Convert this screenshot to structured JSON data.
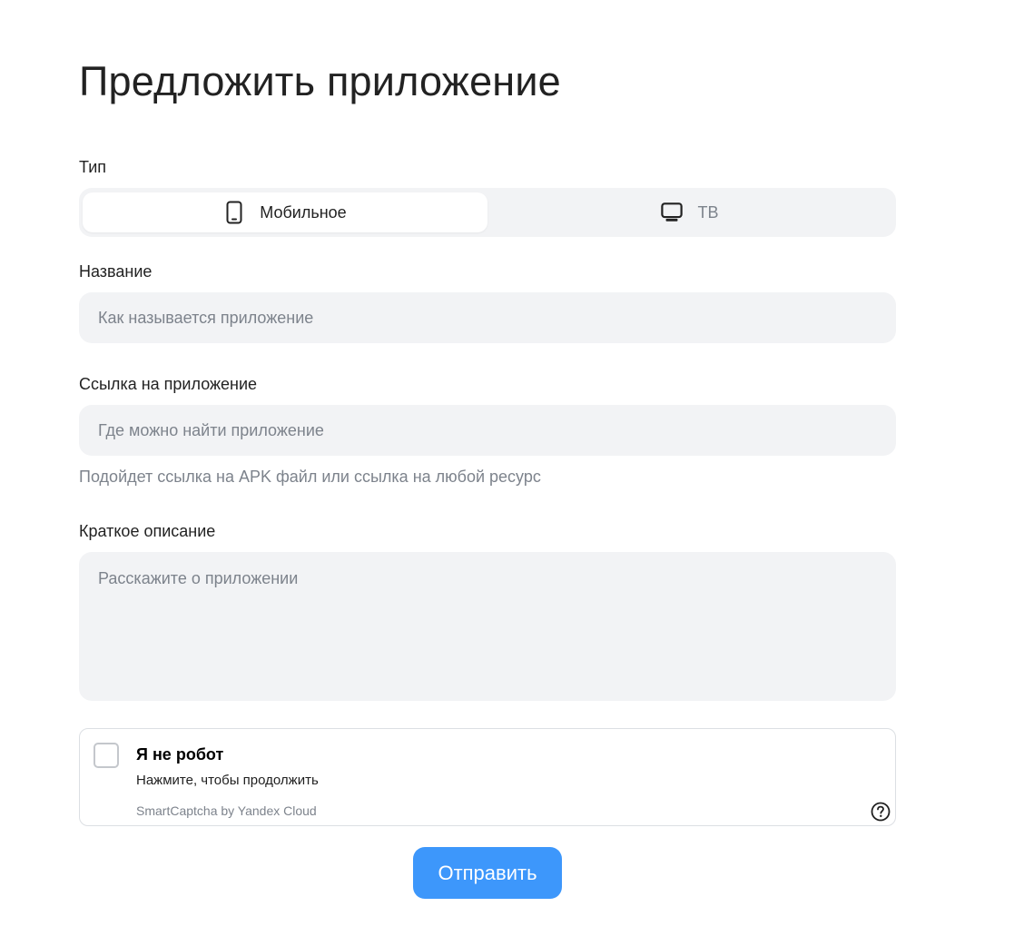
{
  "page": {
    "title": "Предложить приложение"
  },
  "type_field": {
    "label": "Тип",
    "options": [
      {
        "label": "Мобильное",
        "icon": "smartphone-icon",
        "selected": true
      },
      {
        "label": "ТВ",
        "icon": "tv-icon",
        "selected": false
      }
    ]
  },
  "name_field": {
    "label": "Название",
    "placeholder": "Как называется приложение",
    "value": ""
  },
  "link_field": {
    "label": "Ссылка на приложение",
    "placeholder": "Где можно найти приложение",
    "value": "",
    "hint": "Подойдет ссылка на APK файл или ссылка на любой ресурс"
  },
  "description_field": {
    "label": "Краткое описание",
    "placeholder": "Расскажите о приложении",
    "value": ""
  },
  "captcha": {
    "title": "Я не робот",
    "subtitle": "Нажмите, чтобы продолжить",
    "brand": "SmartCaptcha by Yandex Cloud",
    "help_icon": "question-circle-icon",
    "checked": false
  },
  "submit": {
    "label": "Отправить"
  },
  "colors": {
    "accent": "#3d97fb",
    "field_background": "#f2f3f5",
    "muted_text": "#7d838c",
    "text": "#222222"
  }
}
